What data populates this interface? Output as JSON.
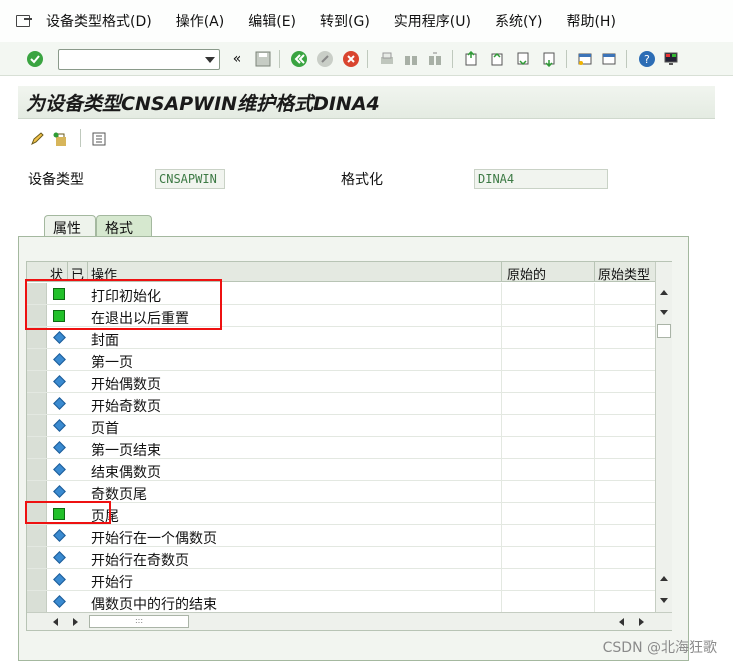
{
  "menubar": {
    "items": [
      "设备类型格式(D)",
      "操作(A)",
      "编辑(E)",
      "转到(G)",
      "实用程序(U)",
      "系统(Y)",
      "帮助(H)"
    ]
  },
  "toolbar": {
    "command_value": "",
    "back_symbol": "«"
  },
  "title": "为设备类型CNSAPWIN维护格式DINA4",
  "fields": {
    "device_type_label": "设备类型",
    "device_type_value": "CNSAPWIN",
    "format_label": "格式化",
    "format_value": "DINA4"
  },
  "tabs": [
    "属性",
    "格式"
  ],
  "grid": {
    "headers": {
      "status": "状",
      "done": "已",
      "operation": "操作",
      "original": "原始的",
      "original_type": "原始类型"
    },
    "rows": [
      {
        "name": "打印初始化",
        "status": "green"
      },
      {
        "name": "在退出以后重置",
        "status": "green"
      },
      {
        "name": "封面",
        "status": "diamond"
      },
      {
        "name": "第一页",
        "status": "diamond"
      },
      {
        "name": "开始偶数页",
        "status": "diamond"
      },
      {
        "name": "开始奇数页",
        "status": "diamond"
      },
      {
        "name": "页首",
        "status": "diamond"
      },
      {
        "name": "第一页结束",
        "status": "diamond"
      },
      {
        "name": "结束偶数页",
        "status": "diamond"
      },
      {
        "name": "奇数页尾",
        "status": "diamond"
      },
      {
        "name": "页尾",
        "status": "green"
      },
      {
        "name": "开始行在一个偶数页",
        "status": "diamond"
      },
      {
        "name": "开始行在奇数页",
        "status": "diamond"
      },
      {
        "name": "开始行",
        "status": "diamond"
      },
      {
        "name": "偶数页中的行的结束",
        "status": "diamond"
      }
    ]
  },
  "hscroll_grip": ":::",
  "watermark": "CSDN @北海狂歌",
  "colors": {
    "accent_green": "#22c02a",
    "status_diamond": "#3a8ad0",
    "highlight_red": "#ee1111"
  }
}
